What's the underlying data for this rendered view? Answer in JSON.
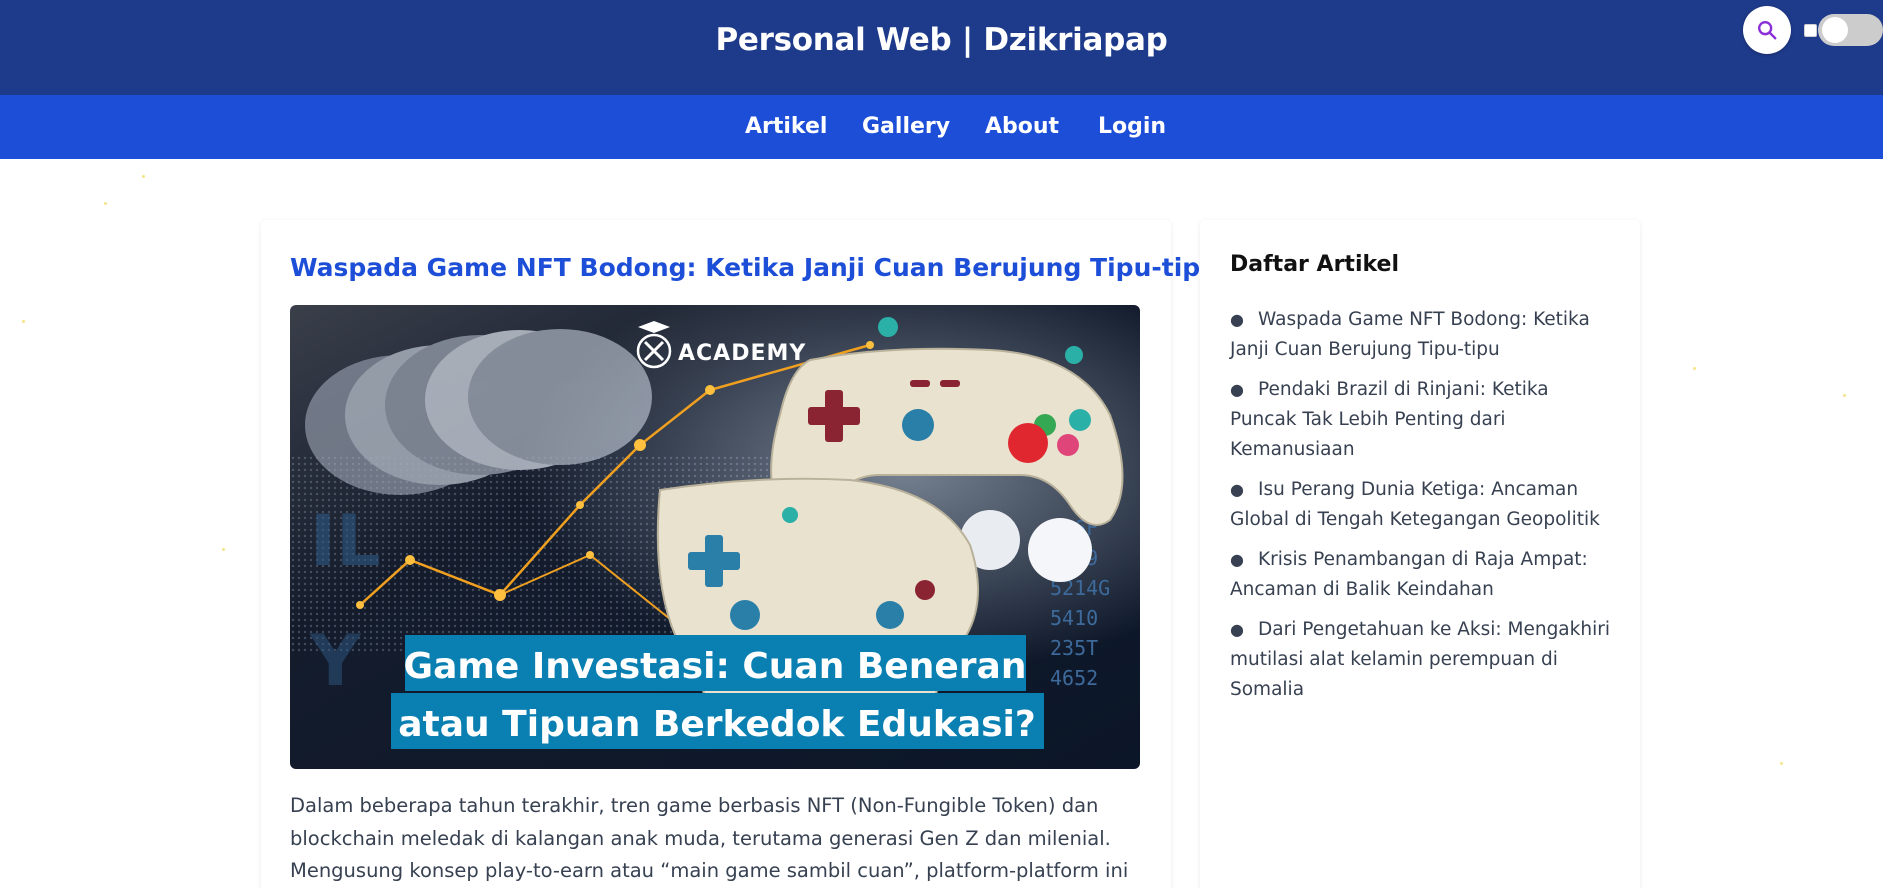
{
  "header": {
    "title": "Personal Web | Dzikriapap",
    "search_icon": "search-icon",
    "dark_mode_toggle": "off"
  },
  "nav": {
    "items": [
      {
        "label": "Artikel"
      },
      {
        "label": "Gallery"
      },
      {
        "label": "About"
      },
      {
        "label": "Login"
      }
    ]
  },
  "article": {
    "title": "Waspada Game NFT Bodong: Ketika Janji Cuan Berujung Tipu-tipu",
    "image": {
      "logo_text": "ACADEMY",
      "caption_line1": "Game Investasi: Cuan Beneran",
      "caption_line2": "atau Tipuan Berkedok Edukasi?"
    },
    "body": "Dalam beberapa tahun terakhir, tren game berbasis NFT (Non-Fungible Token) dan blockchain meledak di kalangan anak muda, terutama generasi Gen Z dan milenial. Mengusung konsep play-to-earn atau “main game sambil cuan”, platform-platform ini menjanjikan keuntungan"
  },
  "sidebar": {
    "title": "Daftar Artikel",
    "items": [
      {
        "label": "Waspada Game NFT Bodong: Ketika Janji Cuan Berujung Tipu-tipu"
      },
      {
        "label": "Pendaki Brazil di Rinjani: Ketika Puncak Tak Lebih Penting dari Kemanusiaan"
      },
      {
        "label": "Isu Perang Dunia Ketiga: Ancaman Global di Tengah Ketegangan Geopolitik"
      },
      {
        "label": "Krisis Penambangan di Raja Ampat: Ancaman di Balik Keindahan"
      },
      {
        "label": "Dari Pengetahuan ke Aksi: Mengakhiri mutilasi alat kelamin perempuan di Somalia"
      }
    ]
  },
  "colors": {
    "header_bg": "#1e3a8a",
    "nav_bg": "#1d4ed8",
    "title_blue": "#1d4ed8",
    "caption_bg": "#0a7fb2"
  }
}
